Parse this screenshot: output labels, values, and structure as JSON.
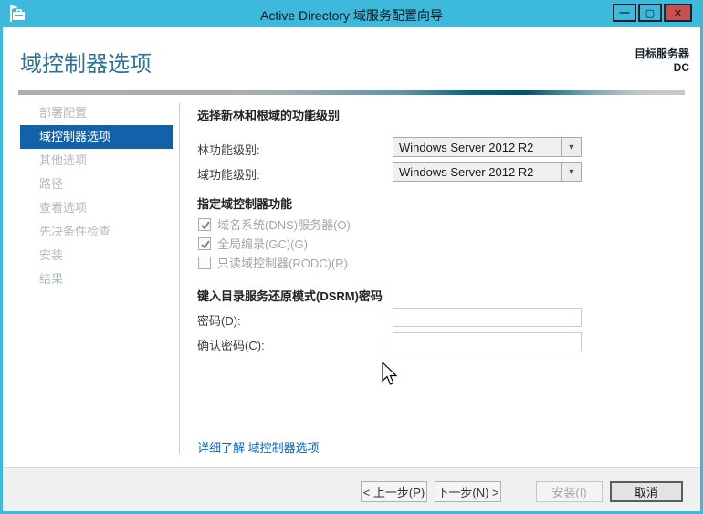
{
  "window": {
    "title": "Active Directory 域服务配置向导",
    "controls": {
      "minimize": "—",
      "maximize": "▢",
      "close": "✕"
    }
  },
  "header": {
    "page_title": "域控制器选项",
    "target_server_label": "目标服务器",
    "target_server_name": "DC"
  },
  "sidebar": {
    "items": [
      {
        "label": "部署配置",
        "state": "dimmed"
      },
      {
        "label": "域控制器选项",
        "state": "active"
      },
      {
        "label": "其他选项",
        "state": "dimmed"
      },
      {
        "label": "路径",
        "state": "dimmed"
      },
      {
        "label": "查看选项",
        "state": "dimmed"
      },
      {
        "label": "先决条件检查",
        "state": "dimmed"
      },
      {
        "label": "安装",
        "state": "dimmed"
      },
      {
        "label": "结果",
        "state": "dimmed"
      }
    ]
  },
  "main": {
    "functional_level_section": {
      "heading": "选择新林和根域的功能级别",
      "forest_label": "林功能级别:",
      "forest_value": "Windows Server 2012 R2",
      "domain_label": "域功能级别:",
      "domain_value": "Windows Server 2012 R2"
    },
    "capabilities_section": {
      "heading": "指定域控制器功能",
      "checkboxes": [
        {
          "label": "域名系统(DNS)服务器(O)",
          "checked": true
        },
        {
          "label": "全局编录(GC)(G)",
          "checked": true
        },
        {
          "label": "只读域控制器(RODC)(R)",
          "checked": false
        }
      ]
    },
    "dsrm_section": {
      "heading": "键入目录服务还原模式(DSRM)密码",
      "password_label": "密码(D):",
      "password_value": "",
      "confirm_label": "确认密码(C):",
      "confirm_value": ""
    },
    "help_link": "详细了解 域控制器选项"
  },
  "footer": {
    "buttons": [
      {
        "label": "< 上一步(P)",
        "enabled": true
      },
      {
        "label": "下一步(N) >",
        "enabled": true
      },
      {
        "label": "安装(I)",
        "enabled": false
      },
      {
        "label": "取消",
        "enabled": true
      }
    ]
  },
  "icons": {
    "dropdown_arrow": "▼"
  },
  "colors": {
    "titlebar": "#3db9dc",
    "selected_sidebar_item": "#1262aa",
    "page_heading": "#2d7498",
    "link": "#0a64c2",
    "close_button": "#c75050",
    "progress_band_dark": "#02506c"
  }
}
